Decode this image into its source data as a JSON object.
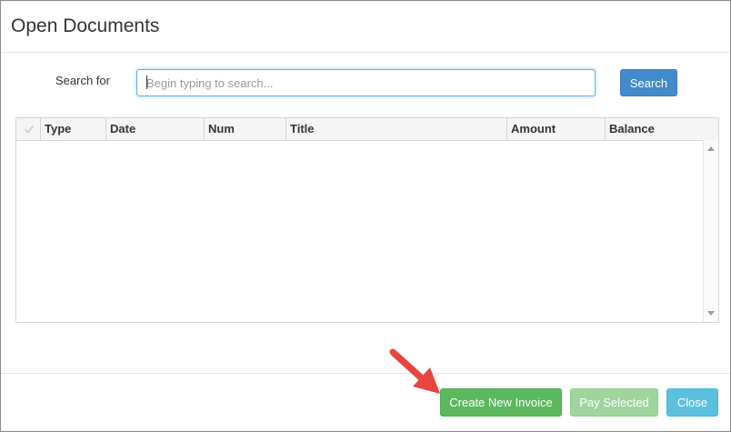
{
  "dialog": {
    "title": "Open Documents"
  },
  "search": {
    "label": "Search for",
    "placeholder": "Begin typing to search...",
    "value": "",
    "button_label": "Search"
  },
  "grid": {
    "columns": [
      "Type",
      "Date",
      "Num",
      "Title",
      "Amount",
      "Balance"
    ],
    "rows": []
  },
  "footer": {
    "create_label": "Create New Invoice",
    "pay_label": "Pay Selected",
    "close_label": "Close"
  },
  "colors": {
    "primary": "#428bca",
    "success": "#5cb85c",
    "success_disabled": "#9fd49f",
    "info": "#5bc0de",
    "annotation_arrow": "#e8463c"
  }
}
